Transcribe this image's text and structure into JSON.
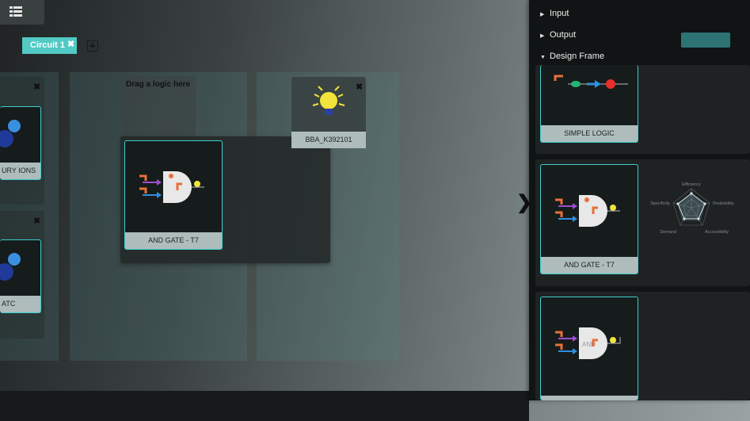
{
  "toolbar": {
    "menu_icon": "grid-list-icon"
  },
  "tabs": [
    {
      "label": "Circuit 1",
      "close": "✖",
      "active": true
    }
  ],
  "tab_add_icon": "plus-box-icon",
  "canvas": {
    "dropzone_text": "Drag a logic here",
    "left_cards": [
      {
        "label": "URY IONS",
        "close": "✖"
      },
      {
        "label": "ATC",
        "close": "✖"
      }
    ],
    "center_card": {
      "label": "AND GATE - T7"
    },
    "light_card": {
      "label": "BBA_K392101",
      "close": "✖"
    }
  },
  "sidebar": {
    "menu": [
      {
        "label": "Input",
        "arrow": "▶"
      },
      {
        "label": "Output",
        "arrow": "▶"
      },
      {
        "label": "Design Frame",
        "arrow": "▼"
      }
    ],
    "toggle": "❯",
    "cards": [
      {
        "label": "SIMPLE LOGIC"
      },
      {
        "label": "AND GATE - T7"
      },
      {
        "label": ""
      }
    ],
    "radar": {
      "axes": [
        "Efficiency",
        "Realiability",
        "Accessibility",
        "Demand",
        "Specificity"
      ]
    },
    "and_text": "AND"
  },
  "colors": {
    "accent": "#52c9c4",
    "card_border": "#3fcfcf",
    "sidebar_bg": "#111414",
    "orange": "#e8703a",
    "purple": "#9b4fd0",
    "blue": "#2f8fe0",
    "bulb": "#f0e43a"
  }
}
